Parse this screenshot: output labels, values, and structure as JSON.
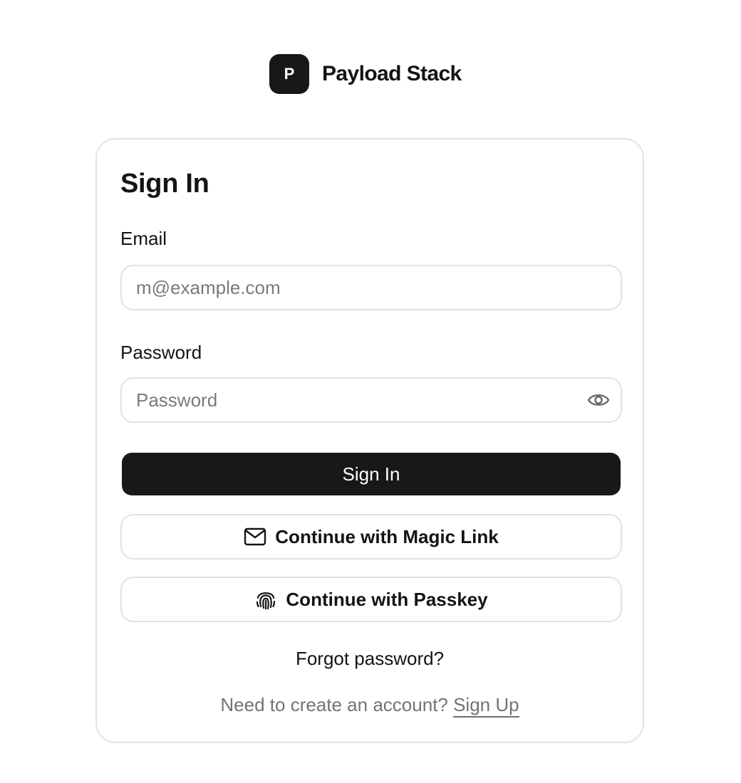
{
  "brand": {
    "logo_letter": "P",
    "name": "Payload Stack"
  },
  "card": {
    "title": "Sign In"
  },
  "email": {
    "label": "Email",
    "placeholder": "m@example.com",
    "value": ""
  },
  "password": {
    "label": "Password",
    "placeholder": "Password",
    "value": "",
    "toggle_icon": "eye-icon"
  },
  "buttons": {
    "sign_in": "Sign In",
    "magic_link": "Continue with Magic Link",
    "magic_link_icon": "mail-icon",
    "passkey": "Continue with Passkey",
    "passkey_icon": "fingerprint-icon"
  },
  "links": {
    "forgot_password": "Forgot password?",
    "signup_prompt": "Need to create an account?",
    "signup_link": "Sign Up"
  },
  "colors": {
    "primary": "#181818",
    "border": "#e3e3e3",
    "muted_text": "#737373"
  }
}
